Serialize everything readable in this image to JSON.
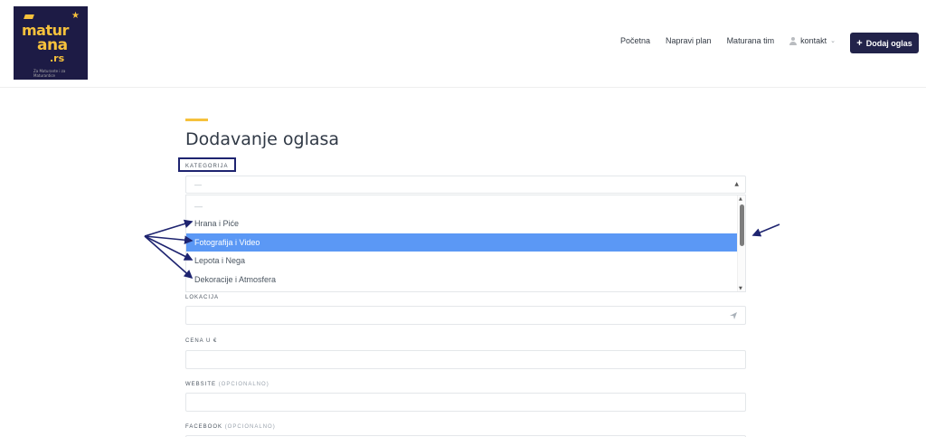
{
  "logo": {
    "line1": "matur",
    "line2": "ana",
    "line3": ".rs",
    "tagline": "Za Maturante i za Maturantice"
  },
  "nav": {
    "items": [
      "Početna",
      "Napravi plan",
      "Maturana tim",
      "kontakt"
    ],
    "cta": "Dodaj oglas"
  },
  "page": {
    "title": "Dodavanje oglasa"
  },
  "form": {
    "category_label": "KATEGORIJA",
    "category_value": "—",
    "options": [
      "—",
      "Hrana i Piće",
      "Fotografija i Video",
      "Lepota i Nega",
      "Dekoracije i Atmosfera"
    ],
    "selected_option": "Fotografija i Video",
    "location_label": "LOKACIJA",
    "price_label": "CENA U €",
    "website_label": "WEBSITE",
    "website_optional": "(OPCIONALNO)",
    "facebook_label": "FACEBOOK",
    "facebook_optional": "(OPCIONALNO)"
  },
  "colors": {
    "accent": "#f6c13c",
    "navy": "#22234a",
    "selected": "#5b98f5",
    "annotation": "#1e2470"
  },
  "icons": [
    "user-icon",
    "chevron-down-icon",
    "plus-icon",
    "location-arrow-icon",
    "caret-up-icon"
  ]
}
